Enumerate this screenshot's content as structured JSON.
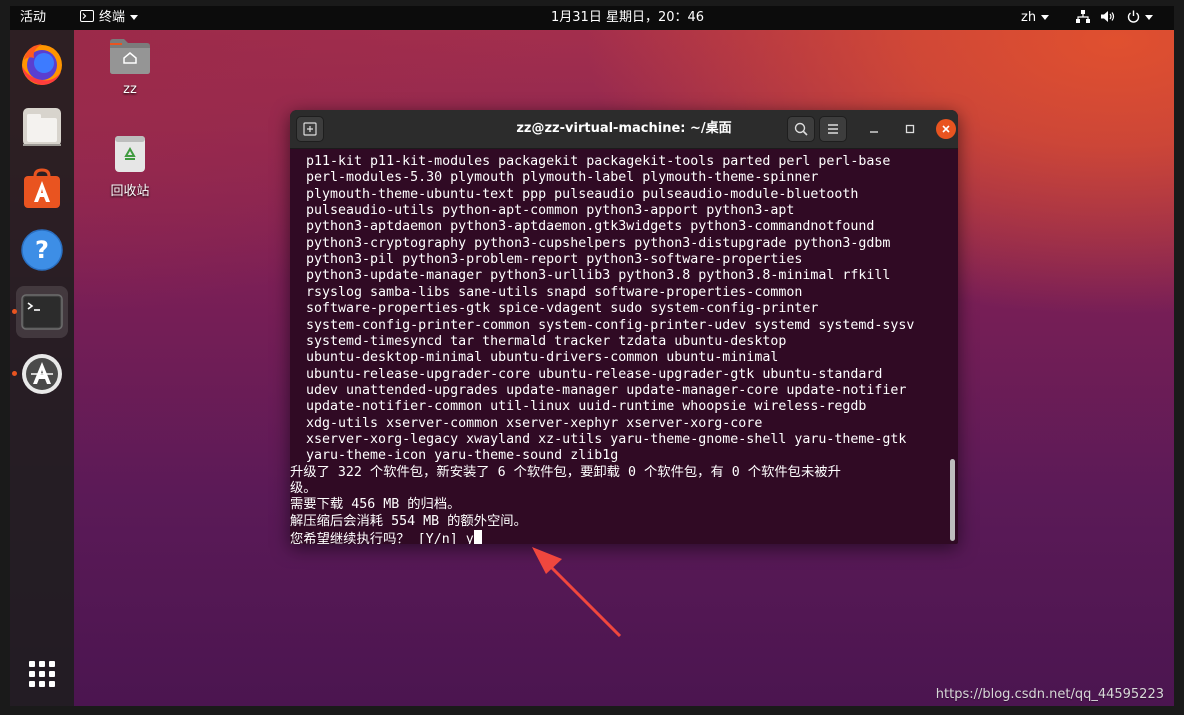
{
  "topbar": {
    "activities": "活动",
    "app_menu": "终端",
    "clock": "1月31日 星期日，20：46",
    "language": "zh"
  },
  "desktop": {
    "home_label": "zz",
    "trash_label": "回收站"
  },
  "dock": {
    "items": [
      "firefox-icon",
      "files-icon",
      "software-center-icon",
      "help-icon",
      "terminal-icon",
      "software-updater-icon",
      "show-apps-icon"
    ]
  },
  "terminal": {
    "title": "zz@zz-virtual-machine: ~/桌面",
    "lines": [
      "  p11-kit p11-kit-modules packagekit packagekit-tools parted perl perl-base",
      "  perl-modules-5.30 plymouth plymouth-label plymouth-theme-spinner",
      "  plymouth-theme-ubuntu-text ppp pulseaudio pulseaudio-module-bluetooth",
      "  pulseaudio-utils python-apt-common python3-apport python3-apt",
      "  python3-aptdaemon python3-aptdaemon.gtk3widgets python3-commandnotfound",
      "  python3-cryptography python3-cupshelpers python3-distupgrade python3-gdbm",
      "  python3-pil python3-problem-report python3-software-properties",
      "  python3-update-manager python3-urllib3 python3.8 python3.8-minimal rfkill",
      "  rsyslog samba-libs sane-utils snapd software-properties-common",
      "  software-properties-gtk spice-vdagent sudo system-config-printer",
      "  system-config-printer-common system-config-printer-udev systemd systemd-sysv",
      "  systemd-timesyncd tar thermald tracker tzdata ubuntu-desktop",
      "  ubuntu-desktop-minimal ubuntu-drivers-common ubuntu-minimal",
      "  ubuntu-release-upgrader-core ubuntu-release-upgrader-gtk ubuntu-standard",
      "  udev unattended-upgrades update-manager update-manager-core update-notifier",
      "  update-notifier-common util-linux uuid-runtime whoopsie wireless-regdb",
      "  xdg-utils xserver-common xserver-xephyr xserver-xorg-core",
      "  xserver-xorg-legacy xwayland xz-utils yaru-theme-gnome-shell yaru-theme-gtk",
      "  yaru-theme-icon yaru-theme-sound zlib1g",
      "升级了 322 个软件包，新安装了 6 个软件包，要卸载 0 个软件包，有 0 个软件包未被升",
      "级。",
      "需要下载 456 MB 的归档。",
      "解压缩后会消耗 554 MB 的额外空间。"
    ],
    "prompt": "您希望继续执行吗？ [Y/n] y"
  },
  "watermark": "https://blog.csdn.net/qq_44595223",
  "colors": {
    "terminal_bg": "#300a24",
    "accent_orange": "#e95420",
    "annotation_arrow": "#f0473e"
  }
}
